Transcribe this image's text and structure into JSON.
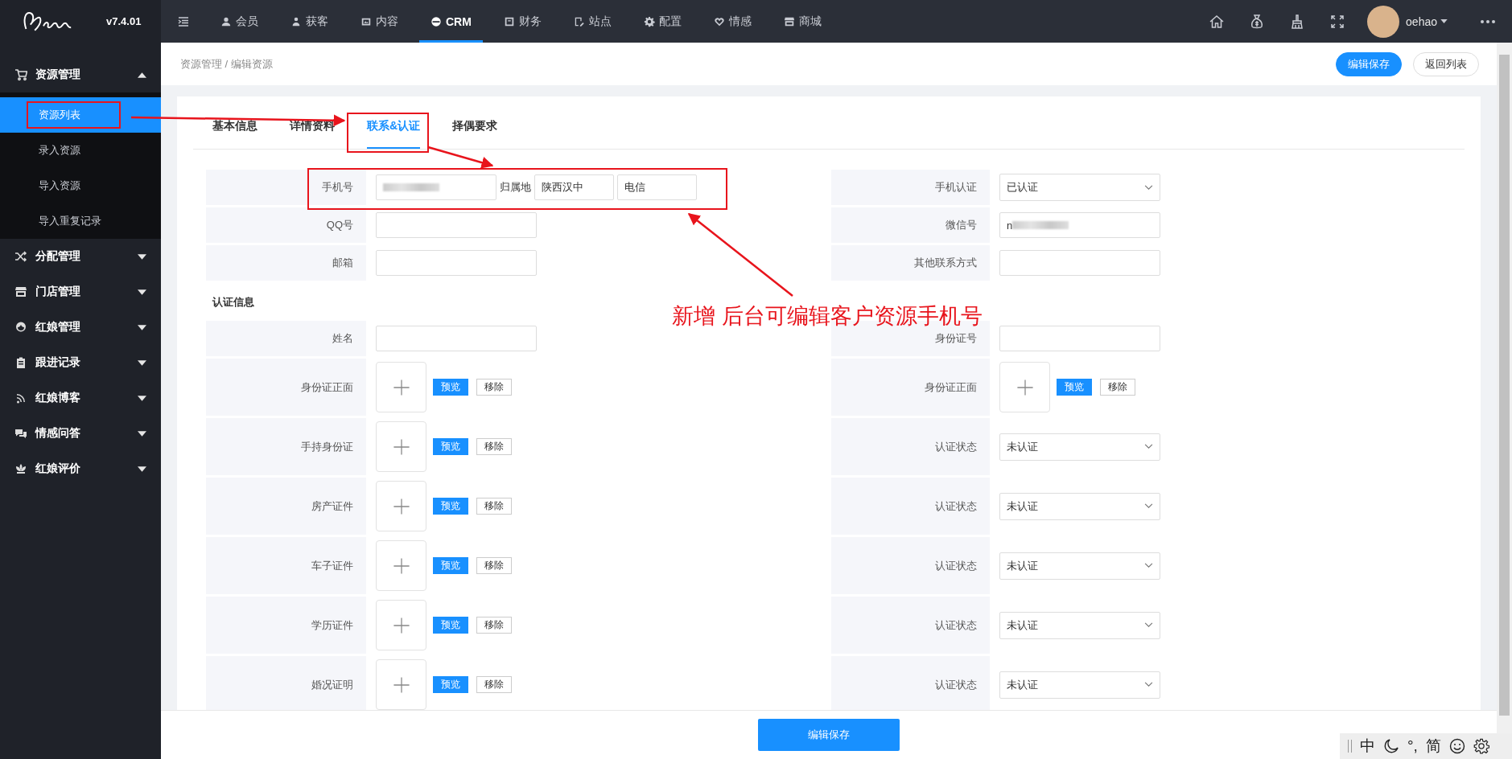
{
  "app": {
    "version": "v7.4.01"
  },
  "top_nav": [
    {
      "label": "会员",
      "selected": false
    },
    {
      "label": "获客",
      "selected": false
    },
    {
      "label": "内容",
      "selected": false
    },
    {
      "label": "CRM",
      "selected": true
    },
    {
      "label": "财务",
      "selected": false
    },
    {
      "label": "站点",
      "selected": false
    },
    {
      "label": "配置",
      "selected": false
    },
    {
      "label": "情感",
      "selected": false
    },
    {
      "label": "商城",
      "selected": false
    }
  ],
  "user": {
    "name": "oehao"
  },
  "sidebar": [
    {
      "label": "资源管理",
      "expanded": true,
      "children": [
        {
          "label": "资源列表",
          "selected": true
        },
        {
          "label": "录入资源",
          "selected": false
        },
        {
          "label": "导入资源",
          "selected": false
        },
        {
          "label": "导入重复记录",
          "selected": false
        }
      ]
    },
    {
      "label": "分配管理",
      "expanded": false
    },
    {
      "label": "门店管理",
      "expanded": false
    },
    {
      "label": "红娘管理",
      "expanded": false
    },
    {
      "label": "跟进记录",
      "expanded": false
    },
    {
      "label": "红娘博客",
      "expanded": false
    },
    {
      "label": "情感问答",
      "expanded": false
    },
    {
      "label": "红娘评价",
      "expanded": false
    }
  ],
  "breadcrumb": "资源管理 / 编辑资源",
  "header_buttons": [
    {
      "label": "编辑保存",
      "kind": "primary"
    },
    {
      "label": "返回列表",
      "kind": "default"
    }
  ],
  "tabs": [
    {
      "label": "基本信息",
      "selected": false
    },
    {
      "label": "详情资料",
      "selected": false
    },
    {
      "label": "联系&认证",
      "selected": true
    },
    {
      "label": "择偶要求",
      "selected": false
    }
  ],
  "contact_rows": [
    {
      "left": {
        "kind": "phone",
        "label": "手机号",
        "blurred": true,
        "location_label": "归属地",
        "location": "陕西汉中",
        "carrier": "电信"
      },
      "right": {
        "kind": "select",
        "label": "手机认证",
        "value": "已认证"
      }
    },
    {
      "left": {
        "kind": "text",
        "label": "QQ号"
      },
      "right": {
        "kind": "text",
        "label": "微信号",
        "value": "n",
        "blurred": true
      }
    },
    {
      "left": {
        "kind": "text",
        "label": "邮箱"
      },
      "right": {
        "kind": "text",
        "label": "其他联系方式"
      }
    }
  ],
  "section_title": "认证信息",
  "auth_rows": [
    {
      "left": {
        "kind": "text",
        "label": "姓名"
      },
      "right": {
        "kind": "text",
        "label": "身份证号"
      }
    },
    {
      "left": {
        "kind": "upload",
        "label": "身份证正面",
        "preview": "预览",
        "remove": "移除"
      },
      "right": {
        "kind": "upload",
        "label": "身份证正面",
        "preview": "预览",
        "remove": "移除"
      }
    },
    {
      "left": {
        "kind": "upload",
        "label": "手持身份证",
        "preview": "预览",
        "remove": "移除"
      },
      "right": {
        "kind": "select",
        "label": "认证状态",
        "value": "未认证"
      }
    },
    {
      "left": {
        "kind": "upload",
        "label": "房产证件",
        "preview": "预览",
        "remove": "移除"
      },
      "right": {
        "kind": "select",
        "label": "认证状态",
        "value": "未认证"
      }
    },
    {
      "left": {
        "kind": "upload",
        "label": "车子证件",
        "preview": "预览",
        "remove": "移除"
      },
      "right": {
        "kind": "select",
        "label": "认证状态",
        "value": "未认证"
      }
    },
    {
      "left": {
        "kind": "upload",
        "label": "学历证件",
        "preview": "预览",
        "remove": "移除"
      },
      "right": {
        "kind": "select",
        "label": "认证状态",
        "value": "未认证"
      }
    },
    {
      "left": {
        "kind": "upload",
        "label": "婚况证明",
        "preview": "预览",
        "remove": "移除"
      },
      "right": {
        "kind": "select",
        "label": "认证状态",
        "value": "未认证"
      }
    }
  ],
  "footer_button": "编辑保存",
  "annotation": {
    "text": "新增 后台可编辑客户资源手机号"
  },
  "ime_bar": {
    "items": [
      {
        "kind": "text",
        "label": "中"
      },
      {
        "kind": "moon"
      },
      {
        "kind": "text",
        "label": "°,"
      },
      {
        "kind": "text",
        "label": "简"
      },
      {
        "kind": "smiley"
      },
      {
        "kind": "gear"
      }
    ]
  }
}
